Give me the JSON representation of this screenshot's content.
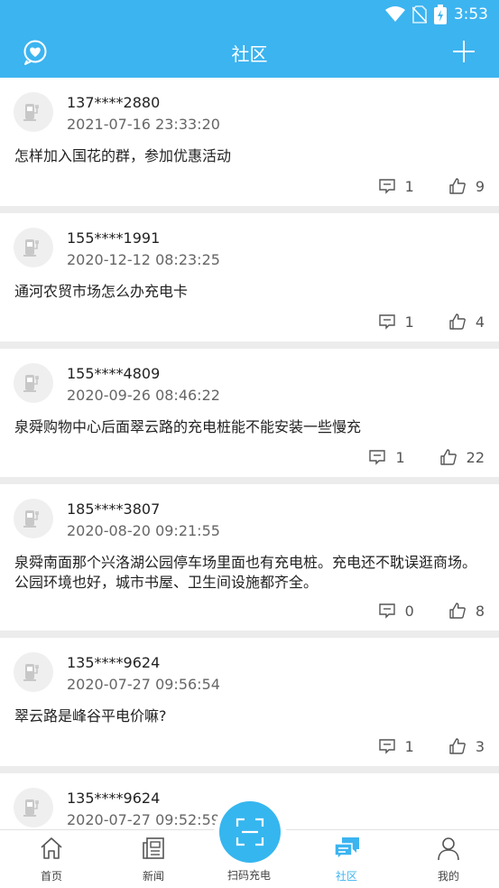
{
  "status_bar": {
    "time": "3:53"
  },
  "header": {
    "title": "社区"
  },
  "posts": [
    {
      "user": "137****2880",
      "time": "2021-07-16 23:33:20",
      "content": "怎样加入国花的群，参加优惠活动",
      "comments": "1",
      "likes": "9"
    },
    {
      "user": "155****1991",
      "time": "2020-12-12 08:23:25",
      "content": "通河农贸市场怎么办充电卡",
      "comments": "1",
      "likes": "4"
    },
    {
      "user": "155****4809",
      "time": "2020-09-26 08:46:22",
      "content": "泉舜购物中心后面翠云路的充电桩能不能安装一些慢充",
      "comments": "1",
      "likes": "22"
    },
    {
      "user": "185****3807",
      "time": "2020-08-20 09:21:55",
      "content": "泉舜南面那个兴洛湖公园停车场里面也有充电桩。充电还不耽误逛商场。公园环境也好，城市书屋、卫生间设施都齐全。",
      "comments": "0",
      "likes": "8"
    },
    {
      "user": "135****9624",
      "time": "2020-07-27 09:56:54",
      "content": "翠云路是峰谷平电价嘛?",
      "comments": "1",
      "likes": "3"
    },
    {
      "user": "135****9624",
      "time": "2020-07-27 09:52:59"
    }
  ],
  "tabs": [
    {
      "label": "首页",
      "icon": "home-icon"
    },
    {
      "label": "新闻",
      "icon": "news-icon"
    },
    {
      "label": "扫码充电",
      "icon": "scan-icon"
    },
    {
      "label": "社区",
      "icon": "community-icon"
    },
    {
      "label": "我的",
      "icon": "profile-icon"
    }
  ],
  "colors": {
    "accent": "#3cb4f0"
  }
}
